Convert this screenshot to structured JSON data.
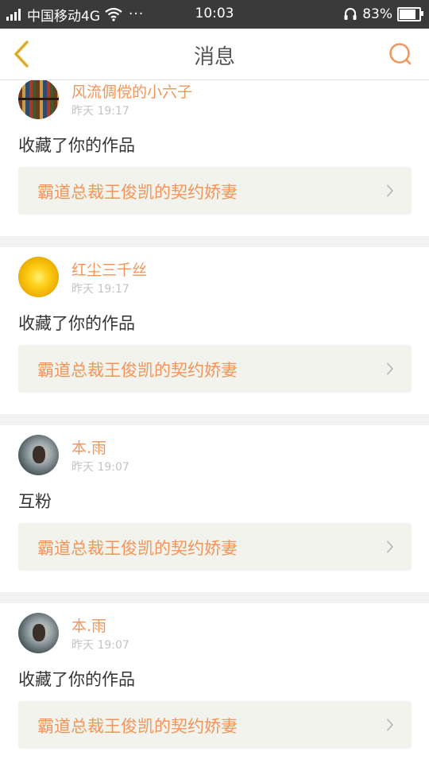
{
  "status_bar": {
    "carrier": "中国移动4G",
    "more": "···",
    "clock": "10:03",
    "battery_percent": "83%",
    "battery_level": 0.83
  },
  "nav": {
    "title": "消息",
    "back_icon": "chevron-left-icon",
    "search_icon": "search-icon"
  },
  "colors": {
    "accent": "#f3955a",
    "back_arrow": "#f0c13a",
    "status_bar_bg": "#3a3a3a",
    "card_bg": "#ffffff",
    "work_bg": "#f3f3ee"
  },
  "messages": [
    {
      "author": "风流倜傥的小六子",
      "time": "昨天 19:17",
      "content": "收藏了你的作品",
      "work_title": "霸道总裁王俊凯的契约娇妻"
    },
    {
      "author": "红尘三千丝",
      "time": "昨天 19:17",
      "content": "收藏了你的作品",
      "work_title": "霸道总裁王俊凯的契约娇妻"
    },
    {
      "author": "本.雨",
      "time": "昨天 19:07",
      "content": "互粉",
      "work_title": "霸道总裁王俊凯的契约娇妻"
    },
    {
      "author": "本.雨",
      "time": "昨天 19:07",
      "content": "收藏了你的作品",
      "work_title": "霸道总裁王俊凯的契约娇妻"
    }
  ]
}
